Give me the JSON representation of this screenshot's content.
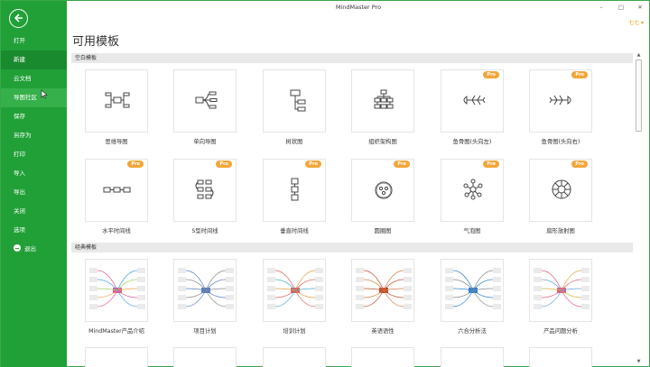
{
  "app": {
    "title": "MindMaster Pro",
    "user": "七七 ▾"
  },
  "window_controls": {
    "minimize": "–",
    "maximize": "□",
    "close": "✕"
  },
  "sidebar": {
    "items": [
      {
        "label": "打开"
      },
      {
        "label": "新建"
      },
      {
        "label": "云文档"
      },
      {
        "label": "导图社区"
      },
      {
        "label": "保存"
      },
      {
        "label": "另存为"
      },
      {
        "label": "打印"
      },
      {
        "label": "导入"
      },
      {
        "label": "导出"
      },
      {
        "label": "关闭"
      },
      {
        "label": "选项"
      },
      {
        "label": "退出"
      }
    ]
  },
  "page": {
    "title": "可用模板"
  },
  "sections": [
    {
      "title": "空白模板"
    },
    {
      "title": "经典模板"
    }
  ],
  "blank_templates": [
    {
      "label": "思维导图",
      "icon": "mindmap-icon",
      "pro": false
    },
    {
      "label": "单向导图",
      "icon": "right-map-icon",
      "pro": false
    },
    {
      "label": "树状图",
      "icon": "tree-icon",
      "pro": false
    },
    {
      "label": "组织架构图",
      "icon": "org-chart-icon",
      "pro": false
    },
    {
      "label": "鱼骨图(头向左)",
      "icon": "fishbone-left-icon",
      "pro": true
    },
    {
      "label": "鱼骨图(头向右)",
      "icon": "fishbone-right-icon",
      "pro": true
    },
    {
      "label": "水平时间线",
      "icon": "horizontal-timeline-icon",
      "pro": true
    },
    {
      "label": "S型时间线",
      "icon": "s-timeline-icon",
      "pro": true
    },
    {
      "label": "垂直时间线",
      "icon": "vertical-timeline-icon",
      "pro": true
    },
    {
      "label": "圆圈图",
      "icon": "circle-map-icon",
      "pro": true
    },
    {
      "label": "气泡图",
      "icon": "bubble-map-icon",
      "pro": true
    },
    {
      "label": "扇形放射图",
      "icon": "sector-radial-icon",
      "pro": true
    }
  ],
  "pro_badge": "Pro",
  "classic_templates": [
    {
      "label": "MindMaster产品介绍"
    },
    {
      "label": "项目计划"
    },
    {
      "label": "培训计划"
    },
    {
      "label": "英语语性"
    },
    {
      "label": "六合分析法"
    },
    {
      "label": "产品问题分析"
    }
  ],
  "colors": {
    "sidebar": "#21a038",
    "sidebar_active": "#1a8a2f",
    "pro_badge": "#f2a63a",
    "user": "#e8a317"
  }
}
